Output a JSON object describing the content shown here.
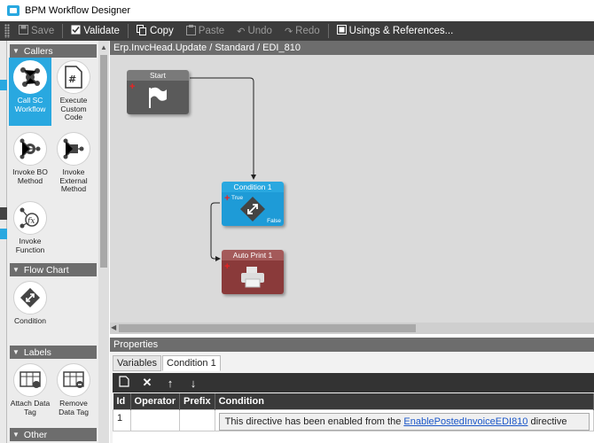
{
  "window": {
    "title": "BPM Workflow Designer"
  },
  "toolbar": {
    "save": "Save",
    "validate": "Validate",
    "copy": "Copy",
    "paste": "Paste",
    "undo": "Undo",
    "redo": "Redo",
    "usings": "Usings & References..."
  },
  "toolbox": {
    "callers": {
      "header": "Callers",
      "items": [
        {
          "label": "Call SC Workflow",
          "icon": "workflow-icon"
        },
        {
          "label": "Execute Custom Code",
          "icon": "code-file-icon"
        },
        {
          "label": "Invoke BO Method",
          "icon": "bo-method-icon"
        },
        {
          "label": "Invoke External Method",
          "icon": "external-method-icon"
        },
        {
          "label": "Invoke Function",
          "icon": "function-icon"
        }
      ]
    },
    "flow_chart": {
      "header": "Flow Chart",
      "items": [
        {
          "label": "Condition",
          "icon": "condition-icon"
        }
      ]
    },
    "labels": {
      "header": "Labels",
      "items": [
        {
          "label": "Attach Data Tag",
          "icon": "attach-tag-icon"
        },
        {
          "label": "Remove Data Tag",
          "icon": "remove-tag-icon"
        }
      ]
    },
    "other": {
      "header": "Other"
    }
  },
  "canvas": {
    "title": "Erp.InvcHead.Update / Standard / EDI_810",
    "nodes": {
      "start": {
        "label": "Start"
      },
      "condition": {
        "label": "Condition 1",
        "true_label": "True",
        "false_label": "False"
      },
      "auto_print": {
        "label": "Auto Print 1"
      }
    }
  },
  "properties": {
    "header": "Properties",
    "tabs": [
      "Variables",
      "Condition 1"
    ],
    "active_tab": "Condition 1",
    "columns": [
      "Id",
      "Operator",
      "Prefix",
      "Condition"
    ],
    "rows": [
      {
        "id": "1",
        "operator": "",
        "prefix": "",
        "condition_prefix": "This directive has been enabled from the ",
        "condition_link": "EnablePostedInvoiceEDI810",
        "condition_suffix": " directive"
      }
    ]
  },
  "colors": {
    "accent": "#29a8e0",
    "toolbar_bg": "#3c3c3c",
    "node_dark": "#5a5a5a",
    "node_error": "#8a3a3a"
  }
}
